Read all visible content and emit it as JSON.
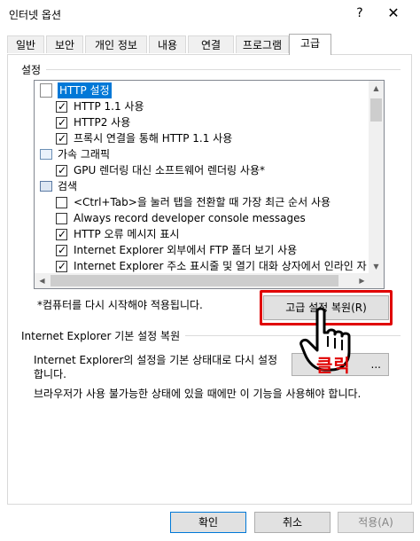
{
  "window": {
    "title": "인터넷 옵션",
    "help_glyph": "?",
    "close_glyph": "✕"
  },
  "tabs": [
    {
      "label": "일반"
    },
    {
      "label": "보안"
    },
    {
      "label": "개인 정보"
    },
    {
      "label": "내용"
    },
    {
      "label": "연결"
    },
    {
      "label": "프로그램"
    },
    {
      "label": "고급"
    }
  ],
  "settings_group": {
    "label": "설정",
    "items": [
      {
        "type": "category",
        "icon": "page-icon",
        "label": "HTTP 설정",
        "selected": true
      },
      {
        "type": "checkbox",
        "label": "HTTP 1.1 사용",
        "checked": true
      },
      {
        "type": "checkbox",
        "label": "HTTP2 사용",
        "checked": true
      },
      {
        "type": "checkbox",
        "label": "프록시 연결을 통해 HTTP 1.1 사용",
        "checked": true
      },
      {
        "type": "category",
        "icon": "image-icon",
        "label": "가속 그래픽"
      },
      {
        "type": "checkbox",
        "label": "GPU 렌더링 대신 소프트웨어 렌더링 사용*",
        "checked": false
      },
      {
        "type": "category",
        "icon": "browse-icon",
        "label": "검색"
      },
      {
        "type": "checkbox",
        "label": "<Ctrl+Tab>을 눌러 탭을 전환할 때 가장 최근 순서 사용",
        "checked": false
      },
      {
        "type": "checkbox",
        "label": "Always record developer console messages",
        "checked": false
      },
      {
        "type": "checkbox",
        "label": "HTTP 오류 메시지 표시",
        "checked": true
      },
      {
        "type": "checkbox",
        "label": "Internet Explorer 외부에서 FTP 폴더 보기 사용",
        "checked": true
      },
      {
        "type": "checkbox",
        "label": "Internet Explorer 주소 표시줄 및 열기 대화 상자에서 인라인 자",
        "checked": true
      }
    ]
  },
  "restart_note": "*컴퓨터를 다시 시작해야 적용됩니다.",
  "restore_advanced_button": "고급 설정 복원(R)",
  "reset_group": {
    "label": "Internet Explorer 기본 설정 복원",
    "description_line1": "Internet Explorer의 설정을 기본 상태대로 다시 설정",
    "description_line2": "합니다.",
    "reset_button": "...",
    "note": "브라우저가 사용 불가능한 상태에 있을 때에만 이 기능을 사용해야 합니다."
  },
  "annotation": {
    "click_text": "클릭",
    "color": "#e00000"
  },
  "footer": {
    "ok": "확인",
    "cancel": "취소",
    "apply": "적용(A)"
  }
}
